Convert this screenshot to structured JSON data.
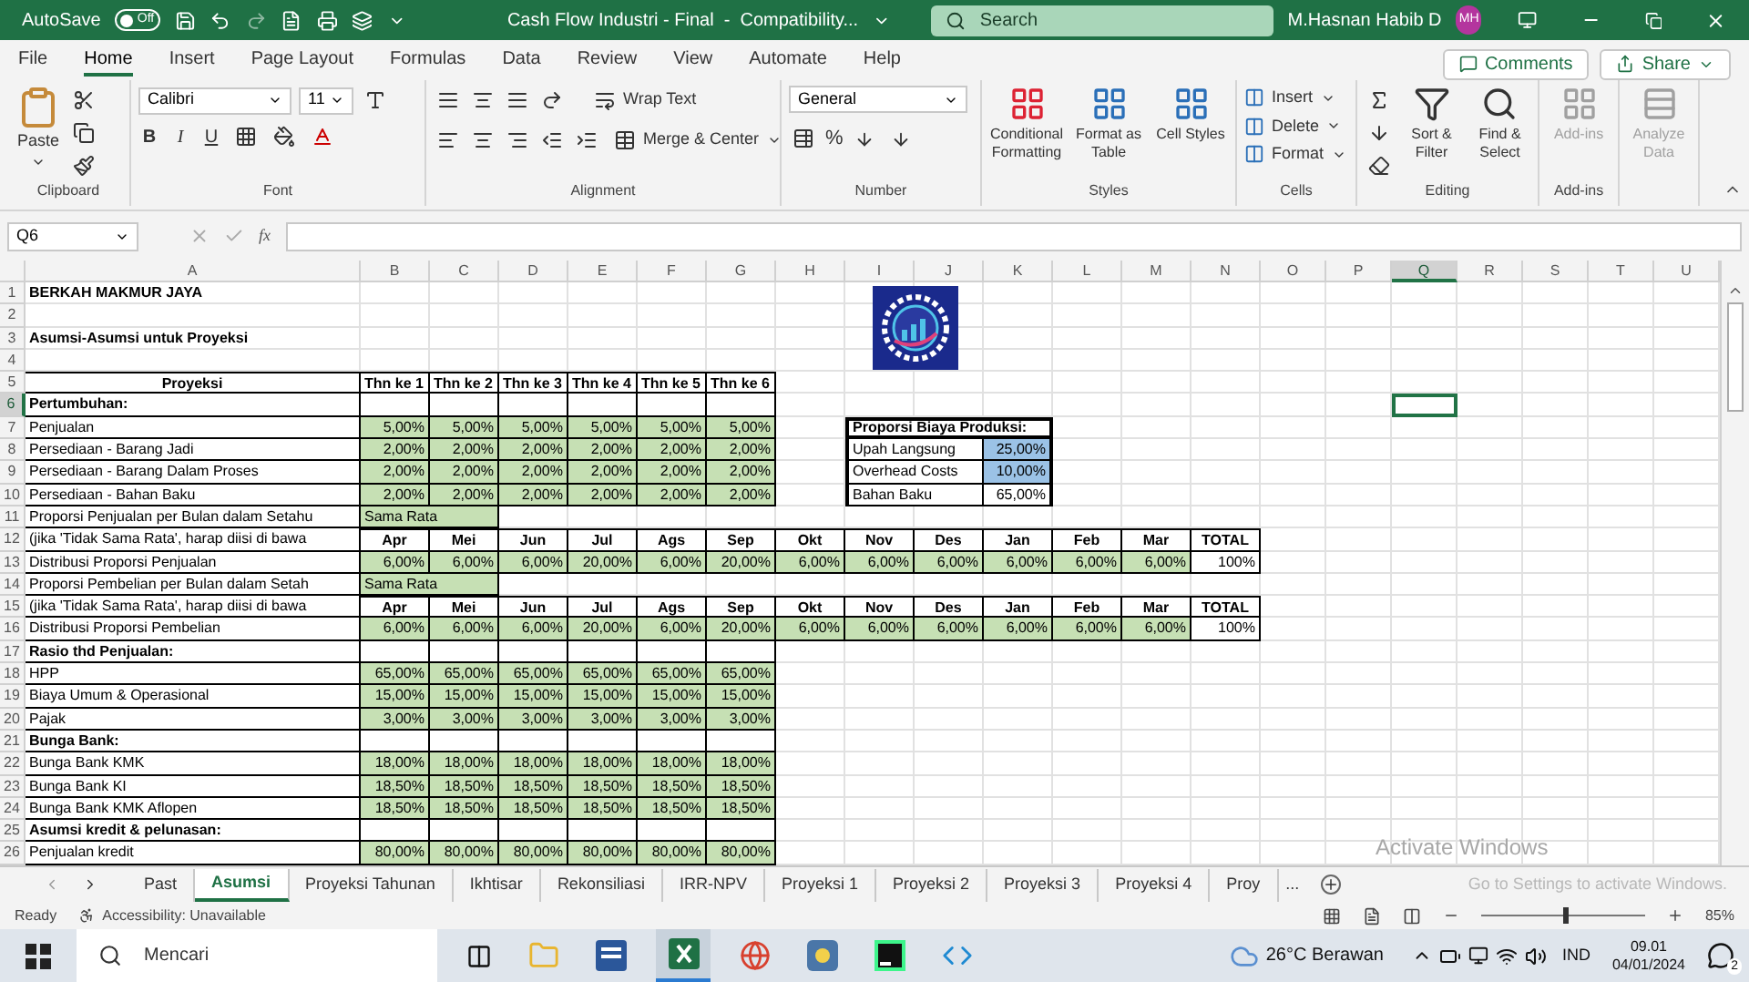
{
  "title_bar": {
    "autosave": {
      "label": "AutoSave",
      "on": false,
      "state_label": "Off"
    },
    "title": "Cash Flow Industri - Final  -  Compatibility...",
    "search": {
      "placeholder": "Search"
    },
    "user": {
      "name": "M.Hasnan Habib D",
      "initials": "MH"
    }
  },
  "menu": {
    "tabs": [
      {
        "label": "File",
        "selected": false
      },
      {
        "label": "Home",
        "selected": true
      },
      {
        "label": "Insert",
        "selected": false
      },
      {
        "label": "Page Layout",
        "selected": false
      },
      {
        "label": "Formulas",
        "selected": false
      },
      {
        "label": "Data",
        "selected": false
      },
      {
        "label": "Review",
        "selected": false
      },
      {
        "label": "View",
        "selected": false
      },
      {
        "label": "Automate",
        "selected": false
      },
      {
        "label": "Help",
        "selected": false
      }
    ],
    "comments": "Comments",
    "share": "Share"
  },
  "ribbon": {
    "groups": [
      {
        "kind": "clipboard",
        "name": "Clipboard",
        "buttons": [
          "Paste"
        ]
      },
      {
        "kind": "font",
        "name": "Font",
        "font": "Calibri",
        "size": "11",
        "buttons": [
          "B",
          "I",
          "U"
        ]
      },
      {
        "kind": "alignment",
        "name": "Alignment",
        "buttons": [
          "Wrap Text",
          "Merge & Center"
        ]
      },
      {
        "kind": "number",
        "name": "Number",
        "format": "General",
        "buttons": [
          "%"
        ]
      },
      {
        "kind": "styles",
        "name": "Styles",
        "buttons": [
          "Conditional Formatting",
          "Format as Table",
          "Cell Styles"
        ]
      },
      {
        "kind": "cells",
        "name": "Cells",
        "buttons": [
          "Insert",
          "Delete",
          "Format"
        ]
      },
      {
        "kind": "editing",
        "name": "Editing",
        "buttons": [
          "Sort & Filter",
          "Find & Select"
        ]
      },
      {
        "kind": "addins",
        "name": "Add-ins",
        "buttons": [
          "Add-ins"
        ]
      },
      {
        "kind": "analysis",
        "buttons": [
          "Analyze Data"
        ]
      }
    ]
  },
  "formula_bar": {
    "name_box": "Q6",
    "function_label": "fx"
  },
  "sheet": {
    "columns": [
      {
        "label": "A",
        "selected": false
      },
      {
        "label": "B",
        "selected": false
      },
      {
        "label": "C",
        "selected": false
      },
      {
        "label": "D",
        "selected": false
      },
      {
        "label": "E",
        "selected": false
      },
      {
        "label": "F",
        "selected": false
      },
      {
        "label": "G",
        "selected": false
      },
      {
        "label": "H",
        "selected": false
      },
      {
        "label": "I",
        "selected": false
      },
      {
        "label": "J",
        "selected": false
      },
      {
        "label": "K",
        "selected": false
      },
      {
        "label": "L",
        "selected": false
      },
      {
        "label": "M",
        "selected": false
      },
      {
        "label": "N",
        "selected": false
      },
      {
        "label": "O",
        "selected": false
      },
      {
        "label": "P",
        "selected": false
      },
      {
        "label": "Q",
        "selected": true
      },
      {
        "label": "R",
        "selected": false
      },
      {
        "label": "S",
        "selected": false
      },
      {
        "label": "T",
        "selected": false
      },
      {
        "label": "U",
        "selected": false
      }
    ],
    "rows": [
      {
        "number": "1",
        "selected": false,
        "kind": "title",
        "label": "BERKAH MAKMUR JAYA"
      },
      {
        "number": "2",
        "selected": false,
        "kind": "blank"
      },
      {
        "number": "3",
        "selected": false,
        "kind": "title",
        "label": "Asumsi-Asumsi untuk Proyeksi"
      },
      {
        "number": "4",
        "selected": false,
        "kind": "blank"
      },
      {
        "number": "5",
        "selected": false,
        "kind": "header",
        "label": "Proyeksi",
        "values": [
          "Thn ke 1",
          "Thn ke 2",
          "Thn ke 3",
          "Thn ke 4",
          "Thn ke 5",
          "Thn ke 6"
        ]
      },
      {
        "number": "6",
        "selected": true,
        "kind": "section",
        "label": "Pertumbuhan:"
      },
      {
        "number": "7",
        "selected": false,
        "kind": "values",
        "label": "Penjualan",
        "values": [
          "5,00%",
          "5,00%",
          "5,00%",
          "5,00%",
          "5,00%",
          "5,00%"
        ]
      },
      {
        "number": "8",
        "selected": false,
        "kind": "values",
        "label": "Persediaan - Barang Jadi",
        "values": [
          "2,00%",
          "2,00%",
          "2,00%",
          "2,00%",
          "2,00%",
          "2,00%"
        ]
      },
      {
        "number": "9",
        "selected": false,
        "kind": "values",
        "label": "Persediaan - Barang Dalam Proses",
        "values": [
          "2,00%",
          "2,00%",
          "2,00%",
          "2,00%",
          "2,00%",
          "2,00%"
        ]
      },
      {
        "number": "10",
        "selected": false,
        "kind": "values",
        "label": "Persediaan - Bahan Baku",
        "values": [
          "2,00%",
          "2,00%",
          "2,00%",
          "2,00%",
          "2,00%",
          "2,00%"
        ]
      },
      {
        "number": "11",
        "selected": false,
        "kind": "choice",
        "label": "Proporsi Penjualan per Bulan dalam Setahu",
        "value": "Sama Rata"
      },
      {
        "number": "12",
        "selected": false,
        "kind": "months",
        "label": "(jika 'Tidak Sama Rata', harap diisi di bawa",
        "values": [
          "Apr",
          "Mei",
          "Jun",
          "Jul",
          "Ags",
          "Sep",
          "Okt",
          "Nov",
          "Des",
          "Jan",
          "Feb",
          "Mar",
          "TOTAL"
        ]
      },
      {
        "number": "13",
        "selected": false,
        "kind": "distribution",
        "label": "Distribusi Proporsi Penjualan",
        "values": [
          "6,00%",
          "6,00%",
          "6,00%",
          "20,00%",
          "6,00%",
          "20,00%",
          "6,00%",
          "6,00%",
          "6,00%",
          "6,00%",
          "6,00%",
          "6,00%"
        ],
        "total": "100%"
      },
      {
        "number": "14",
        "selected": false,
        "kind": "choice",
        "label": "Proporsi Pembelian per Bulan dalam Setah",
        "value": "Sama Rata"
      },
      {
        "number": "15",
        "selected": false,
        "kind": "months",
        "label": "(jika 'Tidak Sama Rata', harap diisi di bawa",
        "values": [
          "Apr",
          "Mei",
          "Jun",
          "Jul",
          "Ags",
          "Sep",
          "Okt",
          "Nov",
          "Des",
          "Jan",
          "Feb",
          "Mar",
          "TOTAL"
        ]
      },
      {
        "number": "16",
        "selected": false,
        "kind": "distribution",
        "label": "Distribusi Proporsi Pembelian",
        "values": [
          "6,00%",
          "6,00%",
          "6,00%",
          "20,00%",
          "6,00%",
          "20,00%",
          "6,00%",
          "6,00%",
          "6,00%",
          "6,00%",
          "6,00%",
          "6,00%"
        ],
        "total": "100%"
      },
      {
        "number": "17",
        "selected": false,
        "kind": "section",
        "label": "Rasio thd Penjualan:"
      },
      {
        "number": "18",
        "selected": false,
        "kind": "values",
        "label": "HPP",
        "values": [
          "65,00%",
          "65,00%",
          "65,00%",
          "65,00%",
          "65,00%",
          "65,00%"
        ]
      },
      {
        "number": "19",
        "selected": false,
        "kind": "values",
        "label": "Biaya Umum & Operasional",
        "values": [
          "15,00%",
          "15,00%",
          "15,00%",
          "15,00%",
          "15,00%",
          "15,00%"
        ]
      },
      {
        "number": "20",
        "selected": false,
        "kind": "values",
        "label": "Pajak",
        "values": [
          "3,00%",
          "3,00%",
          "3,00%",
          "3,00%",
          "3,00%",
          "3,00%"
        ]
      },
      {
        "number": "21",
        "selected": false,
        "kind": "section",
        "label": "Bunga Bank:"
      },
      {
        "number": "22",
        "selected": false,
        "kind": "values",
        "label": "Bunga Bank KMK",
        "values": [
          "18,00%",
          "18,00%",
          "18,00%",
          "18,00%",
          "18,00%",
          "18,00%"
        ]
      },
      {
        "number": "23",
        "selected": false,
        "kind": "values",
        "label": "Bunga Bank KI",
        "values": [
          "18,50%",
          "18,50%",
          "18,50%",
          "18,50%",
          "18,50%",
          "18,50%"
        ]
      },
      {
        "number": "24",
        "selected": false,
        "kind": "values",
        "label": "Bunga Bank KMK Aflopen",
        "values": [
          "18,50%",
          "18,50%",
          "18,50%",
          "18,50%",
          "18,50%",
          "18,50%"
        ]
      },
      {
        "number": "25",
        "selected": false,
        "kind": "section",
        "label": "Asumsi kredit & pelunasan:"
      },
      {
        "number": "26",
        "selected": false,
        "kind": "values",
        "label": "Penjualan kredit",
        "values": [
          "80,00%",
          "80,00%",
          "80,00%",
          "80,00%",
          "80,00%",
          "80,00%"
        ]
      }
    ],
    "cost_table": {
      "title": "Proporsi Biaya Produksi:",
      "items": [
        {
          "label": "Upah Langsung",
          "value": "25,00%",
          "highlighted": true
        },
        {
          "label": "Overhead Costs",
          "value": "10,00%",
          "highlighted": true
        },
        {
          "label": "Bahan Baku",
          "value": "65,00%",
          "highlighted": false
        }
      ]
    }
  },
  "sheet_tabs": {
    "tabs": [
      {
        "label": "Past",
        "selected": false
      },
      {
        "label": "Asumsi",
        "selected": true
      },
      {
        "label": "Proyeksi Tahunan",
        "selected": false
      },
      {
        "label": "Ikhtisar",
        "selected": false
      },
      {
        "label": "Rekonsiliasi",
        "selected": false
      },
      {
        "label": "IRR-NPV",
        "selected": false
      },
      {
        "label": "Proyeksi 1",
        "selected": false
      },
      {
        "label": "Proyeksi 2",
        "selected": false
      },
      {
        "label": "Proyeksi 3",
        "selected": false
      },
      {
        "label": "Proyeksi 4",
        "selected": false
      },
      {
        "label": "Proy",
        "selected": false
      }
    ],
    "more": "..."
  },
  "activation_notice": {
    "title": "Activate Windows",
    "text": "Go to Settings to activate Windows."
  },
  "status_bar": {
    "status": "Ready",
    "accessibility": "Accessibility: Unavailable",
    "zoom": "85%",
    "zoom_slider": {
      "level": 0.5
    }
  },
  "taskbar": {
    "search_placeholder": "Mencari",
    "weather": "26°C Berawan",
    "language": "IND",
    "time": "09.01",
    "date": "04/01/2024",
    "notifications": "2"
  }
}
